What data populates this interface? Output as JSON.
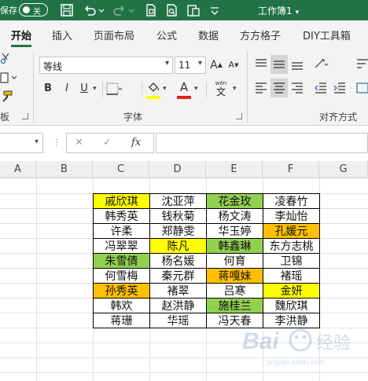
{
  "titlebar": {
    "autosave_label": "保存",
    "autosave_toggle": "关",
    "title": "工作簿1",
    "title_caret": "▾"
  },
  "ribbon_tabs": [
    "开始",
    "插入",
    "页面布局",
    "公式",
    "数据",
    "方方格子",
    "DIY工具箱"
  ],
  "ribbon": {
    "font_name": "等线",
    "font_size": "11",
    "bold": "B",
    "italic": "I",
    "underline": "U",
    "font_color_glyph": "A",
    "increase_font": "A",
    "decrease_font": "A",
    "phonetic_top": "wén",
    "phonetic_bottom": "文",
    "font_group_label": "字体",
    "align_group_label": "对齐方式",
    "left_group_label": "板",
    "highlight_yellow": "#ffff00",
    "font_red": "#e0201c"
  },
  "formula_bar": {
    "cancel_icon": "✕",
    "enter_icon": "✓",
    "fx_label": "fx",
    "name_box_value": ""
  },
  "sheet": {
    "columns": [
      "A",
      "B",
      "C",
      "D",
      "E",
      "F",
      "G"
    ],
    "rows": [
      [
        {
          "t": "戚欣琪",
          "bg": "#ffff00"
        },
        {
          "t": "沈亚萍",
          "bg": "#ffffff"
        },
        {
          "t": "花金玫",
          "bg": "#92d050"
        },
        {
          "t": "凌春竹",
          "bg": "#ffffff"
        }
      ],
      [
        {
          "t": "韩秀英",
          "bg": "#ffffff"
        },
        {
          "t": "钱秋菊",
          "bg": "#ffffff"
        },
        {
          "t": "杨文涛",
          "bg": "#ffffff"
        },
        {
          "t": "李灿怡",
          "bg": "#ffffff"
        }
      ],
      [
        {
          "t": "许柔",
          "bg": "#ffffff"
        },
        {
          "t": "郑静雯",
          "bg": "#ffffff"
        },
        {
          "t": "华玉婷",
          "bg": "#ffffff"
        },
        {
          "t": "孔媛元",
          "bg": "#ffc000"
        }
      ],
      [
        {
          "t": "冯翠翠",
          "bg": "#ffffff"
        },
        {
          "t": "陈凡",
          "bg": "#ffff00"
        },
        {
          "t": "韩鑫琳",
          "bg": "#92d050"
        },
        {
          "t": "东方志桃",
          "bg": "#ffffff"
        }
      ],
      [
        {
          "t": "朱雪倩",
          "bg": "#92d050"
        },
        {
          "t": "杨名媛",
          "bg": "#ffffff"
        },
        {
          "t": "何育",
          "bg": "#ffffff"
        },
        {
          "t": "卫锦",
          "bg": "#ffffff"
        }
      ],
      [
        {
          "t": "何雪梅",
          "bg": "#ffffff"
        },
        {
          "t": "秦元群",
          "bg": "#ffffff"
        },
        {
          "t": "蒋嘎妹",
          "bg": "#ffc000"
        },
        {
          "t": "褚瑶",
          "bg": "#ffffff"
        }
      ],
      [
        {
          "t": "孙秀英",
          "bg": "#ffc000"
        },
        {
          "t": "褚翠",
          "bg": "#ffffff"
        },
        {
          "t": "吕寒",
          "bg": "#ffffff"
        },
        {
          "t": "金妍",
          "bg": "#ffff00"
        }
      ],
      [
        {
          "t": "韩欢",
          "bg": "#ffffff"
        },
        {
          "t": "赵洪静",
          "bg": "#ffffff"
        },
        {
          "t": "施桂兰",
          "bg": "#92d050"
        },
        {
          "t": "魏欣琪",
          "bg": "#ffffff"
        }
      ],
      [
        {
          "t": "蒋珊",
          "bg": "#ffffff"
        },
        {
          "t": "华瑶",
          "bg": "#ffffff"
        },
        {
          "t": "冯天春",
          "bg": "#ffffff"
        },
        {
          "t": "李洪静",
          "bg": "#ffffff"
        }
      ]
    ]
  },
  "watermark": {
    "text": "Bai",
    "sub": "jingyan.baidu.com"
  }
}
